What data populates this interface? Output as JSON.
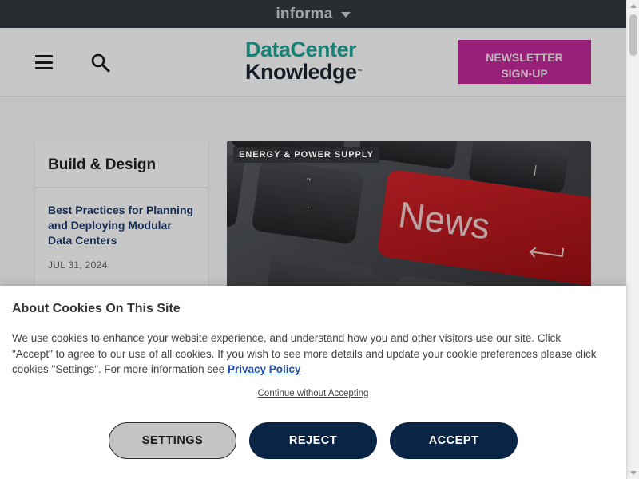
{
  "topbar": {
    "brand": "informa"
  },
  "header": {
    "logo_line1": "DataCenter",
    "logo_line2": "Knowledge",
    "logo_tm": "™",
    "newsletter_line1": "NEWSLETTER",
    "newsletter_line2": "SIGN-UP"
  },
  "sidebar": {
    "title": "Build & Design",
    "article_title": "Best Practices for Planning and Deploying Modular Data Centers",
    "article_date": "JUL 31, 2024"
  },
  "hero": {
    "tag": "ENERGY & POWER SUPPLY",
    "key_text": "News"
  },
  "cookie": {
    "title": "About Cookies On This Site",
    "text": "We use cookies to enhance your website experience, and understand how you and other visitors use our site. Click \"Accept\" to agree to our use of all cookies. If you wish to see more details and update your cookie preferences please click cookies \"Settings\". For more information see ",
    "privacy_link": "Privacy Policy",
    "continue": "Continue without Accepting",
    "settings": "SETTINGS",
    "reject": "REJECT",
    "accept": "ACCEPT"
  },
  "colors": {
    "topbar_bg": "#333a3e",
    "logo_teal": "#1fa79a",
    "newsletter_bg": "#c42a9a",
    "button_navy": "#0a2446",
    "news_key_red": "#c7161c",
    "link_blue": "#1f4fa8"
  },
  "icons": {
    "menu": "hamburger-icon",
    "search": "search-icon",
    "dropdown": "caret-down-icon"
  }
}
